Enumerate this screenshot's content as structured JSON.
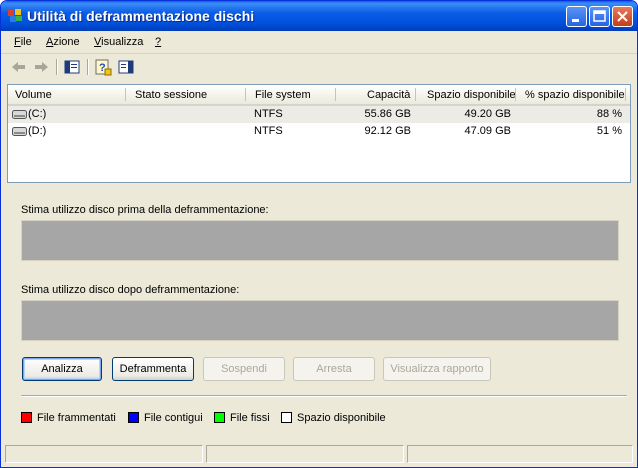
{
  "window": {
    "title": "Utilità di deframmentazione dischi"
  },
  "menu": [
    {
      "label": "File",
      "key": "F",
      "rest": "ile"
    },
    {
      "label": "Azione",
      "key": "A",
      "rest": "zione"
    },
    {
      "label": "Visualizza",
      "key": "V",
      "rest": "isualizza"
    },
    {
      "label": "?",
      "key": "?",
      "rest": ""
    }
  ],
  "toolbar": {
    "icons": [
      "back-arrow-icon",
      "forward-arrow-icon",
      "console-tree-icon",
      "help-icon",
      "show-hide-pane-icon"
    ]
  },
  "volumes": {
    "headers": [
      "Volume",
      "Stato sessione",
      "File system",
      "Capacità",
      "Spazio disponibile",
      "% spazio disponibile"
    ],
    "rows": [
      {
        "volume": "(C:)",
        "session": "",
        "fs": "NTFS",
        "capacity": "55.86 GB",
        "free": "49.20 GB",
        "pct": "88 %"
      },
      {
        "volume": "(D:)",
        "session": "",
        "fs": "NTFS",
        "capacity": "92.12 GB",
        "free": "47.09 GB",
        "pct": "51 %"
      }
    ]
  },
  "estimates": {
    "before_label": "Stima utilizzo disco prima della deframmentazione:",
    "after_label": "Stima utilizzo disco dopo deframmentazione:"
  },
  "buttons": {
    "analyze": "Analizza",
    "defrag": "Deframmenta",
    "pause": "Sospendi",
    "stop": "Arresta",
    "report": "Visualizza rapporto"
  },
  "legend": [
    {
      "label": "File frammentati",
      "color": "#ff0000"
    },
    {
      "label": "File contigui",
      "color": "#0000ff"
    },
    {
      "label": "File fissi",
      "color": "#00ff00"
    },
    {
      "label": "Spazio disponibile",
      "color": "#ffffff"
    }
  ]
}
